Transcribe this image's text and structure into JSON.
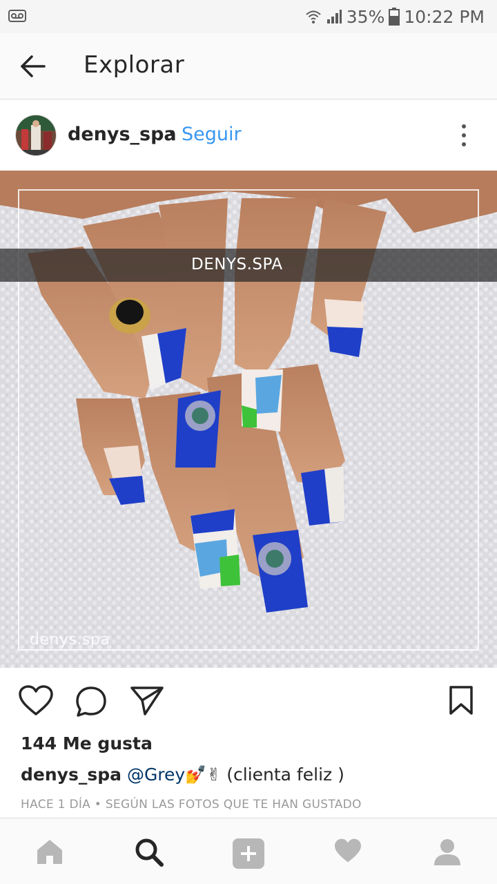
{
  "status_bar": {
    "battery": "35%",
    "time": "10:22 PM",
    "icons": [
      "voicemail-icon",
      "wifi-icon",
      "signal-icon",
      "battery-icon"
    ]
  },
  "header": {
    "title": "Explorar",
    "back_icon": "arrow-left-icon"
  },
  "post": {
    "username": "denys_spa",
    "separator": "•",
    "follow_label": "Seguir",
    "more_icon": "more-vertical-icon",
    "image": {
      "banner_text": "DENYS.SPA",
      "watermark": "denys.spa",
      "description_colors": {
        "nail_blue": "#1f3fc8",
        "towel": "#e2e2e6",
        "skin": "#c98f6e"
      }
    },
    "actions": {
      "like_icon": "heart-outline-icon",
      "comment_icon": "comment-bubble-icon",
      "share_icon": "send-paper-plane-icon",
      "save_icon": "bookmark-icon"
    },
    "likes_text": "144 Me gusta",
    "caption": {
      "username": "denys_spa",
      "mention": "@Grey",
      "emojis": "💅✌",
      "text": "(clienta feliz )"
    },
    "meta": "HACE 1 DÍA • SEGÚN LAS FOTOS QUE TE HAN GUSTADO"
  },
  "bottom_nav": {
    "items": [
      "home-icon",
      "search-icon",
      "add-post-icon",
      "activity-heart-icon",
      "profile-icon"
    ],
    "active": "search-icon"
  },
  "colors": {
    "link_blue": "#3897f0",
    "text": "#262626",
    "muted": "#999999",
    "nav_gray": "#b7b7b7"
  }
}
